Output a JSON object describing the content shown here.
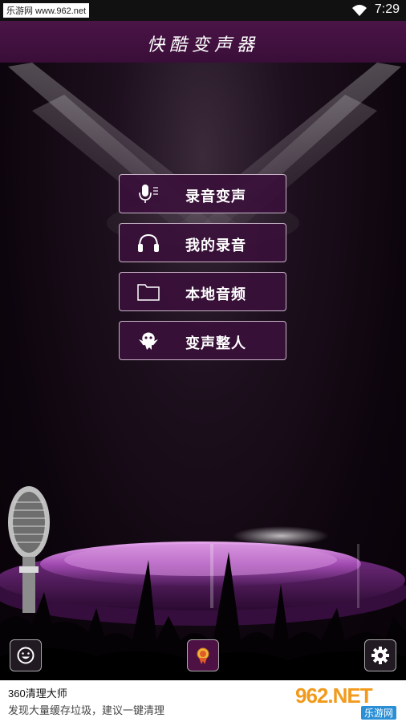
{
  "status_bar": {
    "source_label": "乐游网 www.962.net",
    "time": "7:29"
  },
  "header": {
    "title": "快酷变声器"
  },
  "menu": {
    "items": [
      {
        "label": "录音变声",
        "icon": "microphone-icon"
      },
      {
        "label": "我的录音",
        "icon": "headphones-icon"
      },
      {
        "label": "本地音频",
        "icon": "folder-icon"
      },
      {
        "label": "变声整人",
        "icon": "ghost-icon"
      }
    ]
  },
  "bottom_actions": {
    "left_icon": "smiley-icon",
    "center_icon": "medal-icon",
    "right_icon": "gear-icon"
  },
  "ad": {
    "title": "360清理大师",
    "text": "发现大量缓存垃圾，建议一键清理",
    "logo_main": "962.NET",
    "logo_sub": "乐游网"
  },
  "colors": {
    "header_bg": "#4a1447",
    "button_bg": "#3a103a",
    "button_border": "#c9b4c8",
    "stage_purple": "#b060c0"
  }
}
